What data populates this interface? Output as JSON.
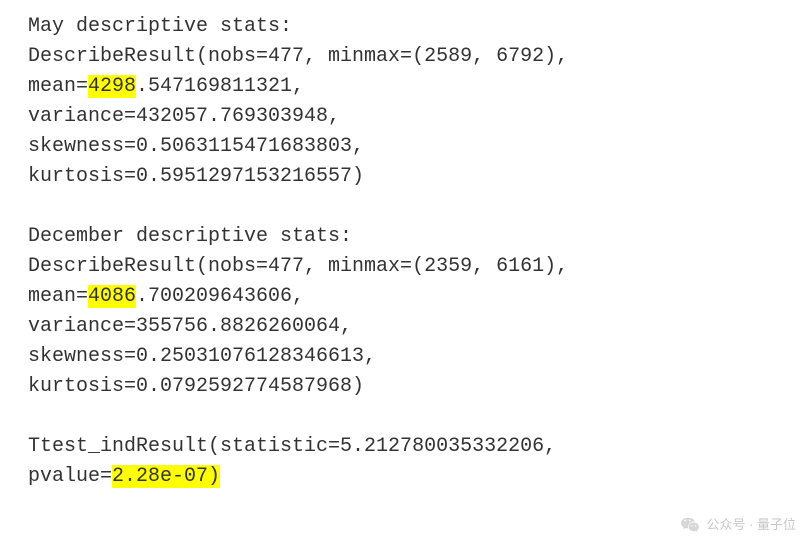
{
  "may": {
    "header": "May descriptive stats:",
    "line1_a": "DescribeResult(nobs=477, minmax=(2589, 6792),",
    "mean_prefix": "mean=",
    "mean_hl": "4298",
    "mean_rest": ".547169811321,",
    "variance": "variance=432057.769303948,",
    "skewness": "skewness=0.5063115471683803,",
    "kurtosis": "kurtosis=0.5951297153216557)"
  },
  "dec": {
    "header": "December descriptive stats:",
    "line1_a": "DescribeResult(nobs=477, minmax=(2359, 6161),",
    "mean_prefix": "mean=",
    "mean_hl": "4086",
    "mean_rest": ".700209643606,",
    "variance": "variance=355756.8826260064,",
    "skewness": "skewness=0.25031076128346613,",
    "kurtosis": "kurtosis=0.0792592774587968)"
  },
  "ttest": {
    "line1": "Ttest_indResult(statistic=5.212780035332206,",
    "pv_prefix": "pvalue=",
    "pv_hl": "2.28e-07)"
  },
  "watermark": {
    "text": "公众号 · 量子位"
  }
}
